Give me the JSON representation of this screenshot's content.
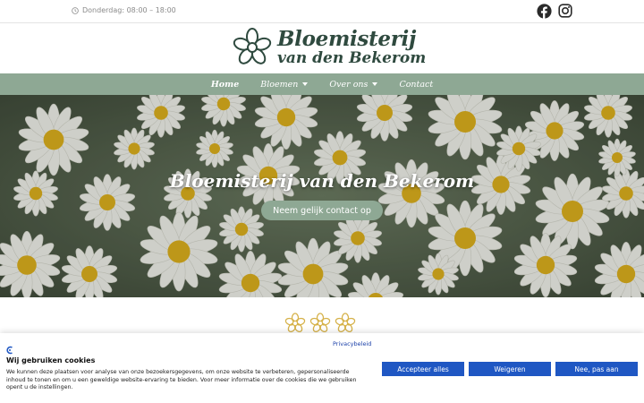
{
  "topbar": {
    "hours": "Donderdag: 08:00 – 18:00",
    "social_icons": [
      "facebook-icon",
      "instagram-icon"
    ]
  },
  "logo": {
    "line1": "Bloemisterij",
    "line2": "van den Bekerom"
  },
  "nav": {
    "items": [
      {
        "label": "Home",
        "dropdown": false
      },
      {
        "label": "Bloemen",
        "dropdown": true
      },
      {
        "label": "Over ons",
        "dropdown": true
      },
      {
        "label": "Contact",
        "dropdown": false
      }
    ]
  },
  "hero": {
    "title": "Bloemisterij van den Bekerom",
    "button": "Neem gelijk contact op"
  },
  "cookie": {
    "privacy_link": "Privacybeleid",
    "title": "Wij gebruiken cookies",
    "text": "We kunnen deze plaatsen voor analyse van onze bezoekersgegevens, om onze website te verbeteren, gepersonaliseerde inhoud te tonen en om u een geweldige website-ervaring te bieden. Voor meer informatie over de cookies die we gebruiken opent u de instellingen.",
    "accept_all": "Accepteer alles",
    "refuse": "Weigeren",
    "customize": "Nee, pas aan"
  },
  "colors": {
    "brand_green": "#8ea894",
    "logo_text": "#2f4a3f",
    "cookie_button": "#1f57c3"
  }
}
